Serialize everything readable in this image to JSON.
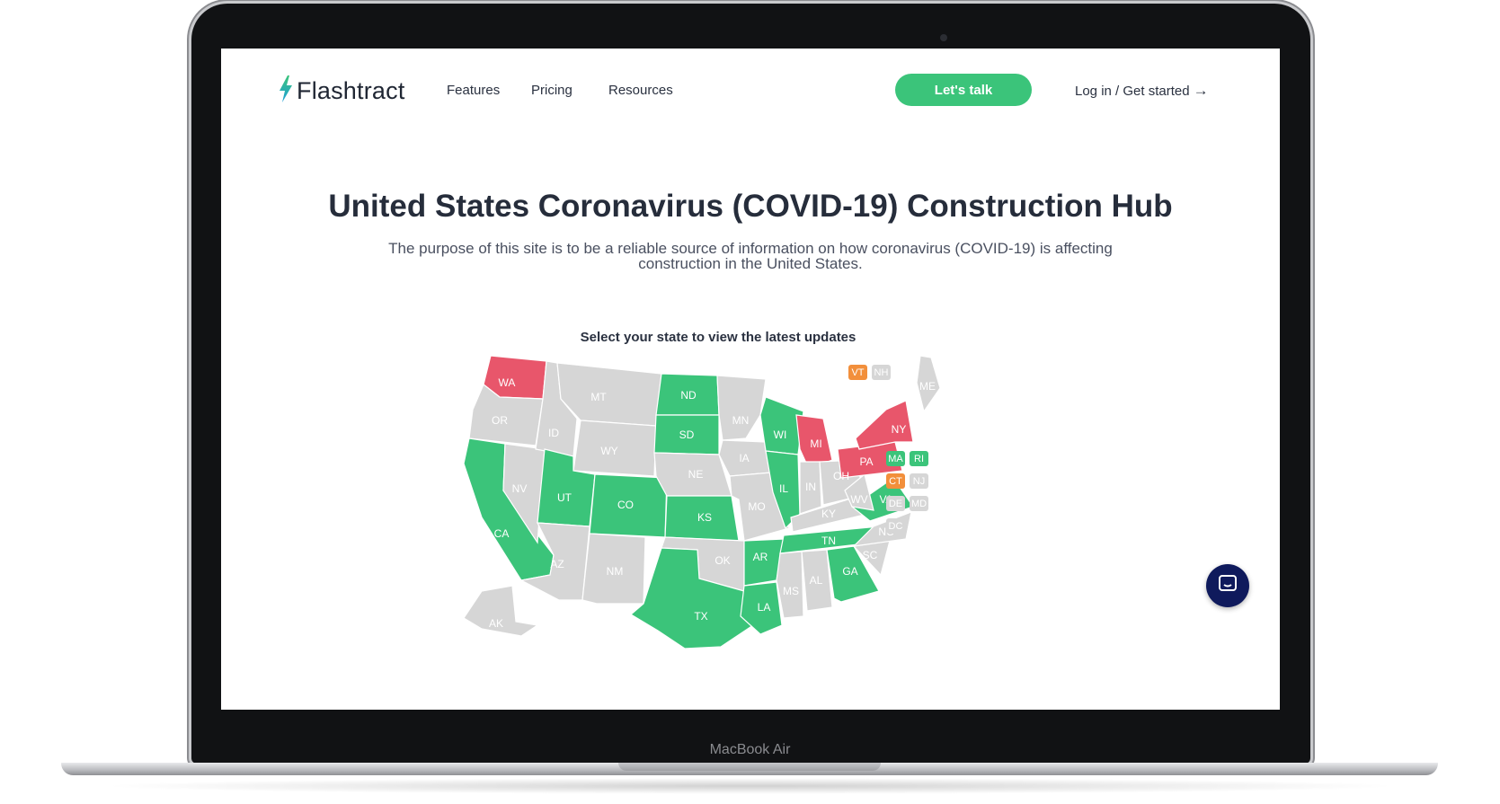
{
  "device": {
    "label": "MacBook Air"
  },
  "brand": {
    "name": "Flashtract",
    "icon": "lightning-bolt-icon",
    "accent": "#3bc47a"
  },
  "nav": {
    "links": [
      "Features",
      "Pricing",
      "Resources"
    ],
    "cta_label": "Let's talk",
    "login_label": "Log in / Get started",
    "login_icon": "arrow-right-icon"
  },
  "hero": {
    "title": "United States Coronavirus (COVID-19) Construction Hub",
    "subtitle": "The purpose of this site is to be a reliable source of information on how coronavirus (COVID-19) is affecting construction in the United States."
  },
  "map": {
    "caption": "Select your state to view the latest updates",
    "status_colors": {
      "green": "#3bc47a",
      "red": "#e8566b",
      "orange": "#f28f3b",
      "gray": "#d6d6d6"
    },
    "states": [
      {
        "code": "WA",
        "status": "red"
      },
      {
        "code": "OR",
        "status": "gray"
      },
      {
        "code": "CA",
        "status": "green"
      },
      {
        "code": "NV",
        "status": "gray"
      },
      {
        "code": "ID",
        "status": "gray"
      },
      {
        "code": "MT",
        "status": "gray"
      },
      {
        "code": "WY",
        "status": "gray"
      },
      {
        "code": "UT",
        "status": "green"
      },
      {
        "code": "AZ",
        "status": "gray"
      },
      {
        "code": "CO",
        "status": "green"
      },
      {
        "code": "NM",
        "status": "gray"
      },
      {
        "code": "ND",
        "status": "green"
      },
      {
        "code": "SD",
        "status": "green"
      },
      {
        "code": "NE",
        "status": "gray"
      },
      {
        "code": "KS",
        "status": "green"
      },
      {
        "code": "OK",
        "status": "gray"
      },
      {
        "code": "TX",
        "status": "green"
      },
      {
        "code": "MN",
        "status": "gray"
      },
      {
        "code": "IA",
        "status": "gray"
      },
      {
        "code": "MO",
        "status": "gray"
      },
      {
        "code": "AR",
        "status": "green"
      },
      {
        "code": "LA",
        "status": "green"
      },
      {
        "code": "WI",
        "status": "green"
      },
      {
        "code": "IL",
        "status": "green"
      },
      {
        "code": "MI",
        "status": "red"
      },
      {
        "code": "IN",
        "status": "gray"
      },
      {
        "code": "OH",
        "status": "gray"
      },
      {
        "code": "KY",
        "status": "gray"
      },
      {
        "code": "TN",
        "status": "green"
      },
      {
        "code": "MS",
        "status": "gray"
      },
      {
        "code": "AL",
        "status": "gray"
      },
      {
        "code": "GA",
        "status": "green"
      },
      {
        "code": "SC",
        "status": "gray"
      },
      {
        "code": "NC",
        "status": "gray"
      },
      {
        "code": "VA",
        "status": "green"
      },
      {
        "code": "WV",
        "status": "gray"
      },
      {
        "code": "PA",
        "status": "red"
      },
      {
        "code": "NY",
        "status": "red"
      },
      {
        "code": "ME",
        "status": "gray"
      },
      {
        "code": "AK",
        "status": "gray"
      }
    ],
    "chips": [
      {
        "code": "VT",
        "status": "orange"
      },
      {
        "code": "NH",
        "status": "gray"
      },
      {
        "code": "MA",
        "status": "green"
      },
      {
        "code": "RI",
        "status": "green"
      },
      {
        "code": "CT",
        "status": "orange"
      },
      {
        "code": "NJ",
        "status": "gray"
      },
      {
        "code": "DE",
        "status": "gray"
      },
      {
        "code": "MD",
        "status": "gray"
      },
      {
        "code": "DC",
        "status": "gray"
      }
    ]
  },
  "chat": {
    "icon": "chat-bubble-icon"
  }
}
